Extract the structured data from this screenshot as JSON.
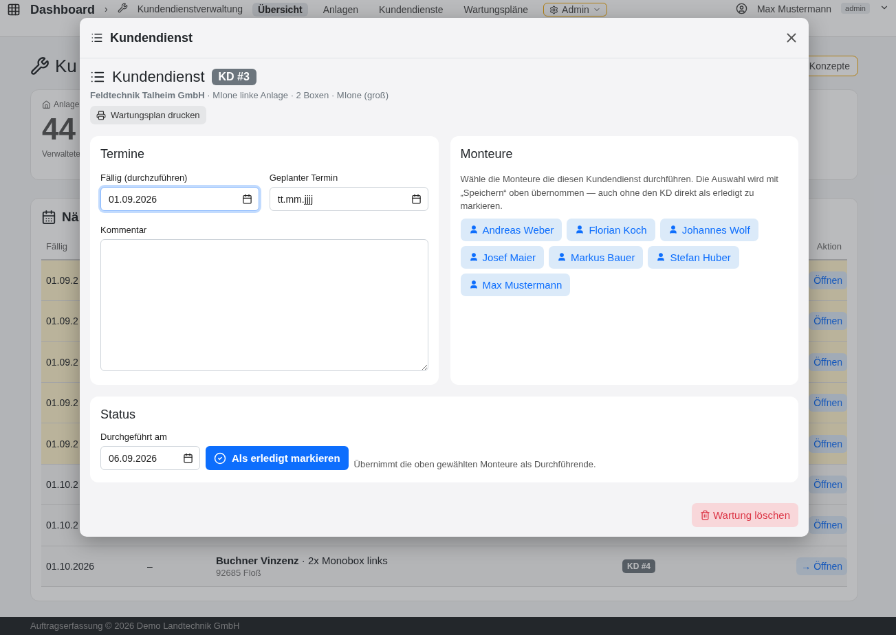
{
  "navbar": {
    "brand": "Dashboard",
    "separator": "›",
    "breadcrumb": "Kundendienstverwaltung",
    "items": [
      {
        "label": "Übersicht",
        "selected": true
      },
      {
        "label": "Anlagen",
        "selected": false
      },
      {
        "label": "Kundendienste",
        "selected": false
      },
      {
        "label": "Wartungspläne",
        "selected": false
      }
    ],
    "admin": "Admin",
    "user": "Max Mustermann",
    "role": "admin"
  },
  "page": {
    "title": "Ku",
    "concepts_button": "Konzepte",
    "stat": {
      "label": "Anlage",
      "value": "44",
      "caption": "Verwaltete"
    },
    "table": {
      "title": "Nä",
      "columns": [
        "Fällig",
        "Aktion"
      ],
      "rows": [
        {
          "due": "01.09.2",
          "overdue": true,
          "action": "Öffnen"
        },
        {
          "due": "01.09.2",
          "overdue": true,
          "action": "Öffnen"
        },
        {
          "due": "01.09.2",
          "overdue": true,
          "action": "Öffnen"
        },
        {
          "due": "01.09.2",
          "overdue": true,
          "action": "Öffnen"
        },
        {
          "due": "01.09.2",
          "overdue": true,
          "action": "Öffnen"
        },
        {
          "due": "01.10.2",
          "overdue": false,
          "action": "Öffnen"
        },
        {
          "due": "01.10.2",
          "overdue": false,
          "action": "Öffnen"
        },
        {
          "due": "01.10.2026",
          "overdue": false,
          "planned": "–",
          "customer": "**Buchner Vinzenz** · 2x Monobox links",
          "place": "92685 Floß",
          "badge": "KD #4",
          "action": "→ Öffnen"
        }
      ]
    },
    "footer": "Auftragserfassung © 2026 Demo Landtechnik GmbH"
  },
  "modal": {
    "header": "Kundendienst",
    "title": "Kundendienst",
    "badge": "KD #3",
    "subtitle": "**Feldtechnik Talheim GmbH** · MIone linke Anlage · 2 Boxen · MIone (groß)",
    "print_button": "Wartungsplan drucken",
    "termine": {
      "title": "Termine",
      "due": {
        "label": "Fällig (durchzuführen)",
        "value": "01.09.2026",
        "focused": true
      },
      "planned": {
        "label": "Geplanter Termin",
        "placeholder": "tt.mm.jjjj",
        "focused": false
      },
      "comment": {
        "label": "Kommentar"
      }
    },
    "monteure": {
      "title": "Monteure",
      "hint": "Wähle die Monteure die diesen Kundendienst durchführen. Die Auswahl wird mit „Speichern“ oben übernommen — auch ohne den KD direkt als erledigt zu markieren.",
      "people": [
        {
          "name": "Andreas Weber",
          "selected": false
        },
        {
          "name": "Florian Koch",
          "selected": false
        },
        {
          "name": "Johannes Wolf",
          "selected": false
        },
        {
          "name": "Josef Maier",
          "selected": false
        },
        {
          "name": "Markus Bauer",
          "selected": false
        },
        {
          "name": "Stefan Huber",
          "selected": false
        },
        {
          "name": "Max Mustermann",
          "selected": false
        }
      ]
    },
    "status": {
      "title": "Status",
      "label": "Durchgeführt am",
      "value": "06.09.2026",
      "button": "Als erledigt markieren",
      "note": "Übernimmt die oben gewählten Monteure als Durchführende."
    },
    "delete_button": "Wartung löschen"
  }
}
